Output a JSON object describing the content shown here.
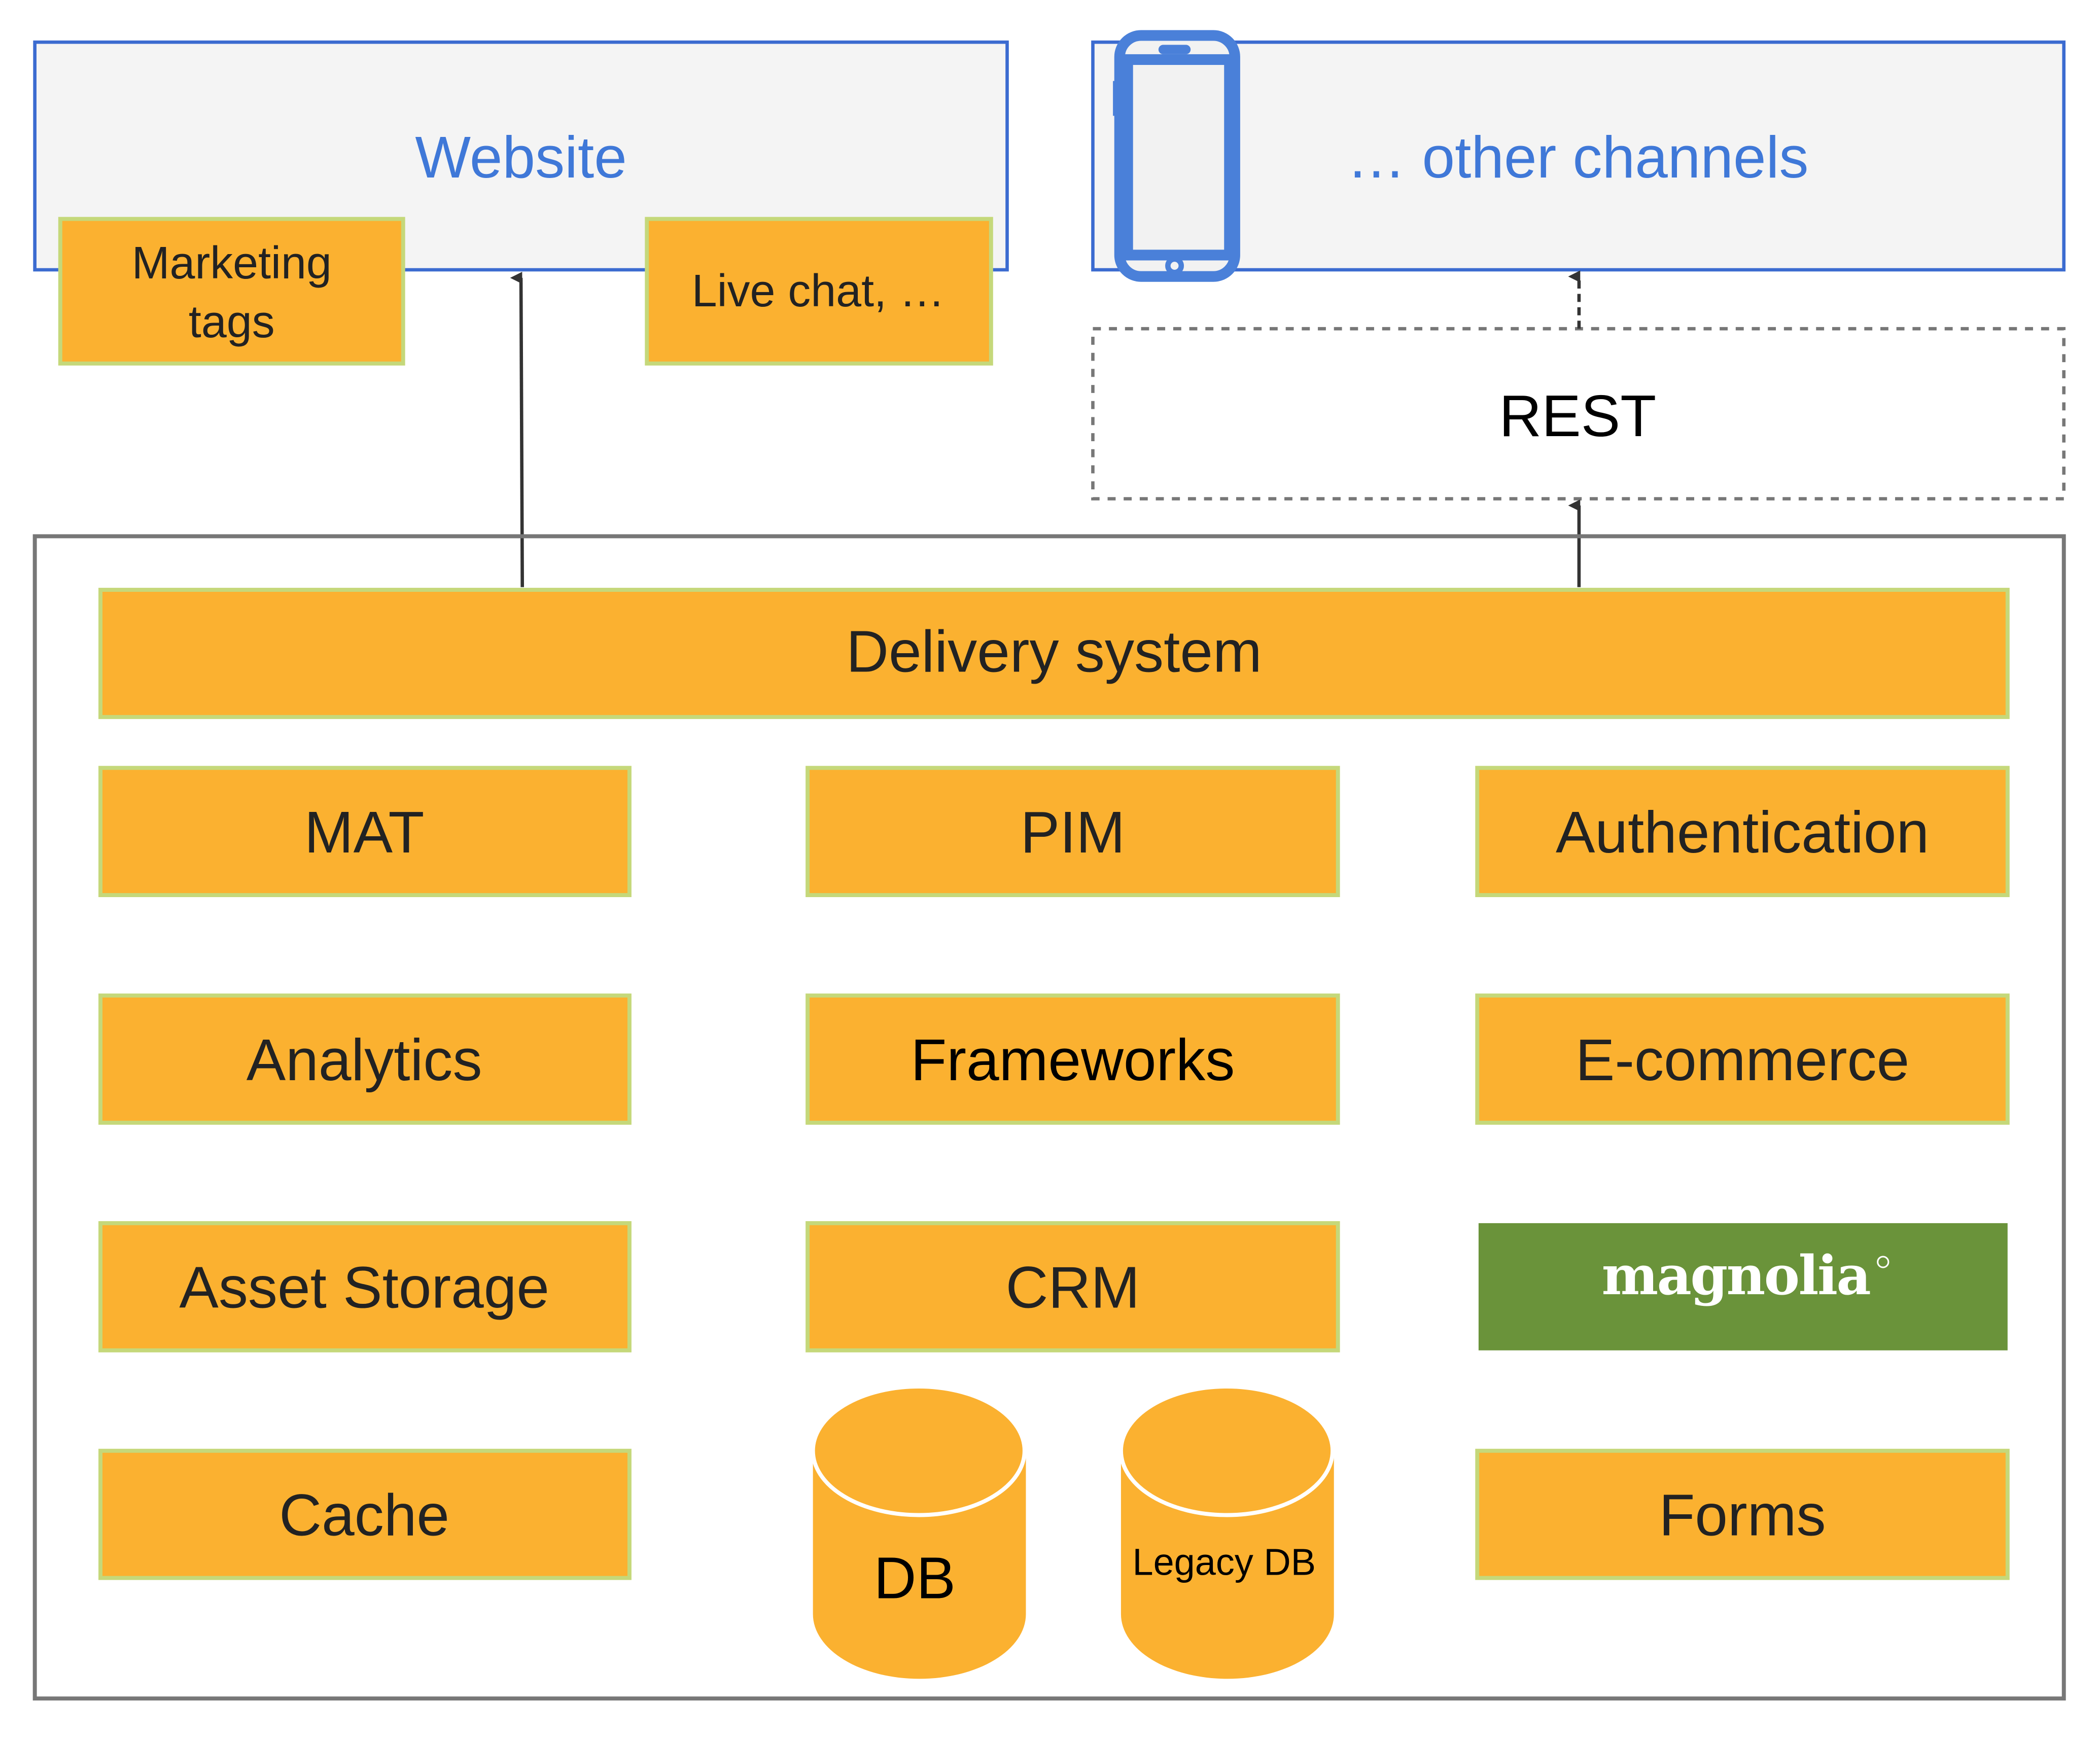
{
  "colors": {
    "component_fill": "#fbb130",
    "component_border": "#c5d87a",
    "channel_border": "#3b6bd0",
    "channel_fill": "#f4f4f4",
    "channel_text": "#3f78d8",
    "magnolia_green": "#6a933a",
    "container_border": "#777777",
    "arrow": "#333333"
  },
  "channels": {
    "website": "Website",
    "other": "… other channels",
    "phone_icon": "smartphone-icon"
  },
  "addons": {
    "marketing_line1": "Marketing",
    "marketing_line2": "tags",
    "live_chat": "Live chat, …"
  },
  "rest": "REST",
  "delivery": "Delivery system",
  "components": {
    "mat": "MAT",
    "pim": "PIM",
    "authentication": "Authentication",
    "analytics": "Analytics",
    "frameworks": "Frameworks",
    "ecommerce": "E-commerce",
    "asset_storage": "Asset Storage",
    "crm": "CRM",
    "magnolia_logo": "magnolia",
    "cache": "Cache",
    "forms": "Forms"
  },
  "databases": {
    "db": "DB",
    "legacy": "Legacy DB"
  }
}
